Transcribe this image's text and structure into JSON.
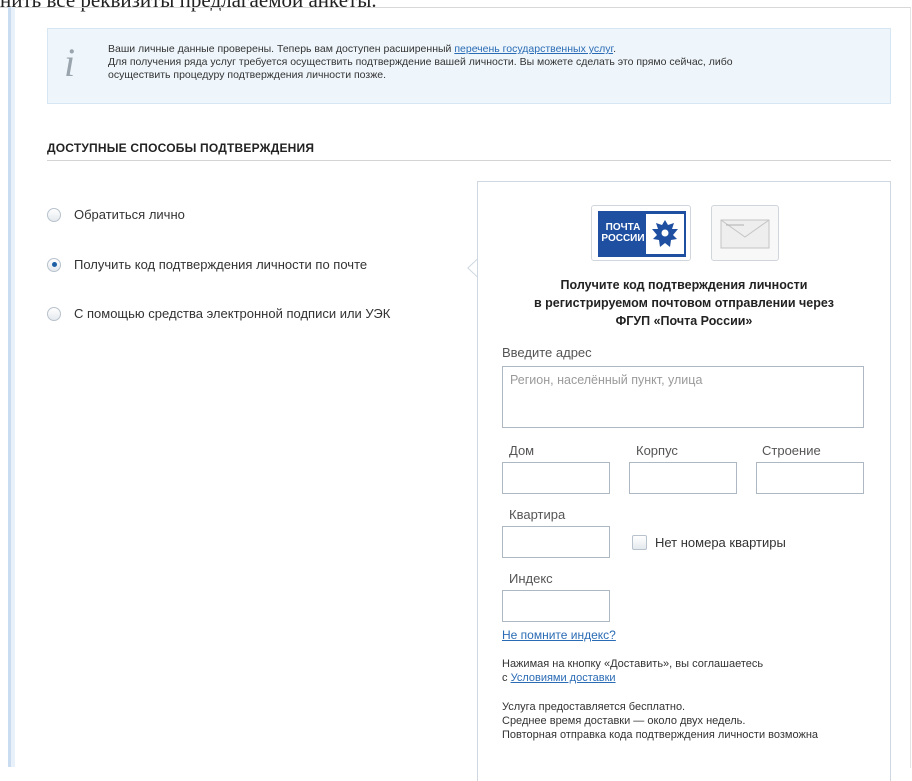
{
  "top_fragment": "нить все реквизиты предлагаемой анкеты.",
  "info": {
    "line1_prefix": "Ваши личные данные проверены. Теперь вам доступен расширенный ",
    "line1_link": "перечень государственных услуг",
    "line1_suffix": ".",
    "line2": "Для получения ряда услуг требуется осуществить подтверждение вашей личности. Вы можете сделать это прямо сейчас, либо",
    "line3": "осуществить процедуру подтверждения личности позже."
  },
  "section_title": "ДОСТУПНЫЕ СПОСОБЫ ПОДТВЕРЖДЕНИЯ",
  "options": [
    {
      "label": "Обратиться лично",
      "checked": false
    },
    {
      "label": "Получить код подтверждения личности по почте",
      "checked": true
    },
    {
      "label": "С помощью средства электронной подписи или УЭК",
      "checked": false
    }
  ],
  "panel": {
    "logo_text_line1": "ПОЧТА",
    "logo_text_line2": "РОССИИ",
    "heading_line1": "Получите код подтверждения личности",
    "heading_line2": "в регистрируемом почтовом отправлении через",
    "heading_line3": "ФГУП «Почта России»",
    "address_label": "Введите адрес",
    "address_placeholder": "Регион, населённый пункт, улица",
    "house_label": "Дом",
    "building_label": "Корпус",
    "structure_label": "Строение",
    "apartment_label": "Квартира",
    "no_apartment_label": "Нет номера квартиры",
    "index_label": "Индекс",
    "forgot_index_link": "Не помните индекс?",
    "agree_text": "Нажимая на кнопку «Доставить», вы соглашаетесь",
    "agree_prefix": "с ",
    "agree_link": "Условиями доставки",
    "service_line1": "Услуга предоставляется бесплатно.",
    "service_line2": "Среднее время доставки — около двух недель.",
    "service_line3": "Повторная отправка кода подтверждения личности возможна"
  },
  "colors": {
    "accent": "#2a6bb5",
    "info_bg": "#eef6fb",
    "pochta_blue": "#1f4fa0"
  }
}
